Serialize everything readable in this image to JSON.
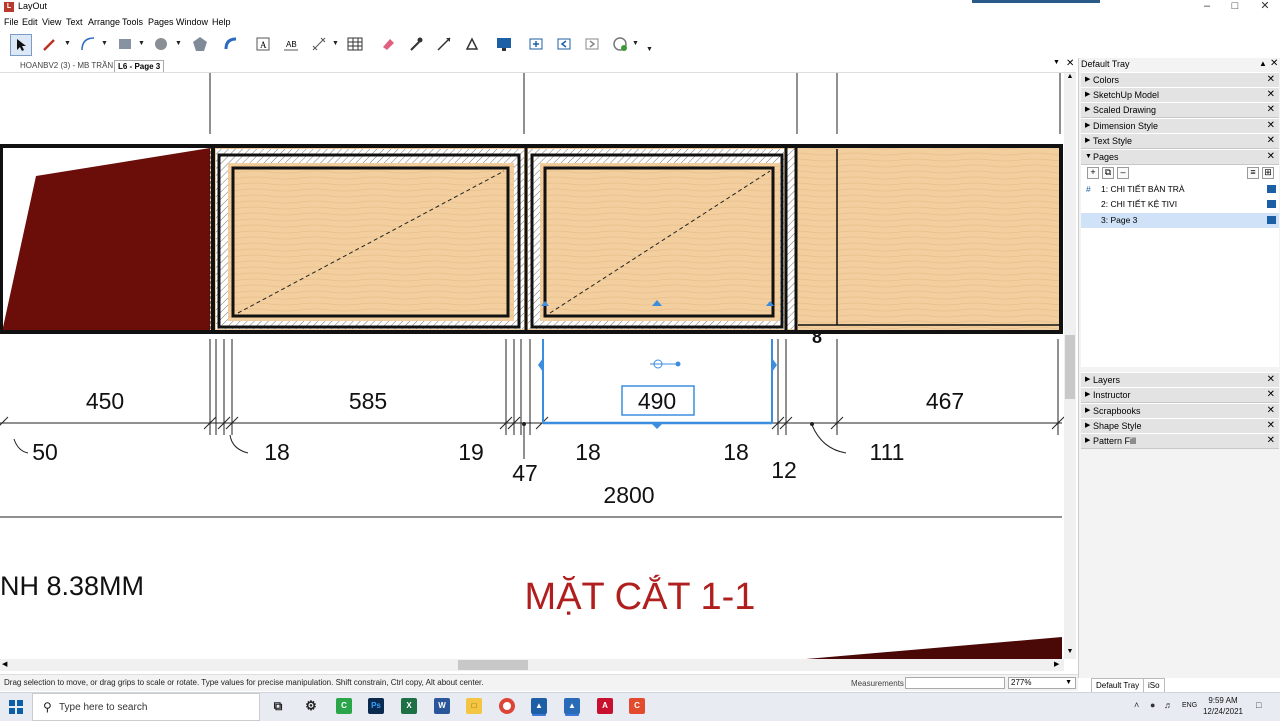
{
  "window": {
    "title": "LayOut",
    "app_icon_letter": "L"
  },
  "menu": [
    "File",
    "Edit",
    "View",
    "Text",
    "Arrange",
    "Tools",
    "Pages",
    "Window",
    "Help"
  ],
  "toolbar": {
    "icons": [
      "select-tool",
      "pencil-tool",
      "arc-tool",
      "rectangle-tool",
      "circle-tool",
      "polygon-tool",
      "offset-tool",
      "text-tool",
      "label-tool",
      "dimension-tool",
      "table-tool",
      "eraser-tool",
      "style-tool",
      "split-tool",
      "join-tool",
      "presentation",
      "add-page",
      "previous-page",
      "next-page",
      "share"
    ]
  },
  "doc_tabs": [
    "HOANBV2 (3) - MB TRẦN",
    "L6 - Page 3"
  ],
  "drawing": {
    "dimensions_top": [
      "450",
      "585",
      "490",
      "467"
    ],
    "dimensions_bottom": [
      "50",
      "18",
      "19",
      "47",
      "18",
      "18",
      "12",
      "111"
    ],
    "total": "2800",
    "section_title": "MẶT CẮT 1-1",
    "left_note": "NH 8.38MM",
    "marker_digit": "8",
    "accent": "#b01e1e",
    "selection_color": "#3b8de0"
  },
  "tray": {
    "title": "Default Tray",
    "panels_top": [
      "Colors",
      "SketchUp Model",
      "Scaled Drawing",
      "Dimension Style",
      "Text Style",
      "Pages"
    ],
    "pages": [
      {
        "label": "1:  CHI TIẾT BÀN TRÀ"
      },
      {
        "label": "2:  CHI TIẾT KỆ TIVI"
      },
      {
        "label": "3:  Page 3"
      }
    ],
    "page_marker": "#",
    "panels_bottom": [
      "Layers",
      "Instructor",
      "Scrapbooks",
      "Shape Style",
      "Pattern Fill"
    ],
    "tabs": [
      "Default Tray",
      "iSo"
    ]
  },
  "status": {
    "message": "Drag selection to move, or drag grips to scale or rotate. Type values for precise manipulation. Shift constrain, Ctrl copy, Alt about center.",
    "measurements_label": "Measurements",
    "zoom": "277%"
  },
  "taskbar": {
    "search_placeholder": "Type here to search",
    "lang": "ENG",
    "time": "9:59 AM",
    "date": "12/24/2021"
  }
}
